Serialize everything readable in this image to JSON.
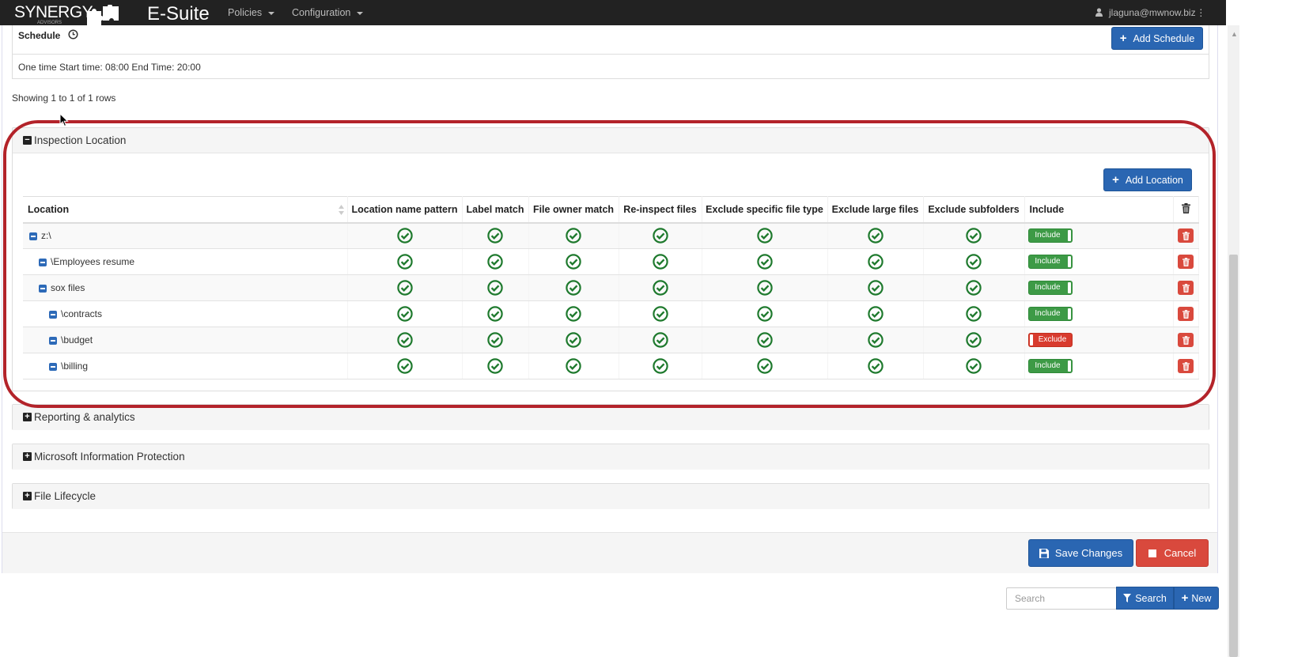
{
  "navbar": {
    "brand_synergy": "SYNERGY",
    "brand_sub": "ADVISORS",
    "brand_esuite": "E-Suite",
    "menu": [
      {
        "label": "Policies"
      },
      {
        "label": "Configuration"
      }
    ],
    "user_email": "jlaguna@mwnow.biz"
  },
  "schedule": {
    "title": "Schedule",
    "add_label": "Add Schedule",
    "entry": "One time Start time: 08:00 End Time: 20:00"
  },
  "showing": "Showing 1 to 1 of 1 rows",
  "inspection": {
    "title": "Inspection Location",
    "add_label": "Add Location",
    "columns": [
      "Location",
      "Location name pattern",
      "Label match",
      "File owner match",
      "Re-inspect files",
      "Exclude specific file type",
      "Exclude large files",
      "Exclude subfolders",
      "Include"
    ],
    "rows": [
      {
        "name": "z:\\",
        "level": 0,
        "include": "Include"
      },
      {
        "name": "\\Employees resume",
        "level": 1,
        "include": "Include"
      },
      {
        "name": "sox files",
        "level": 1,
        "include": "Include"
      },
      {
        "name": "\\contracts",
        "level": 2,
        "include": "Include"
      },
      {
        "name": "\\budget",
        "level": 2,
        "include": "Exclude"
      },
      {
        "name": "\\billing",
        "level": 2,
        "include": "Include"
      }
    ]
  },
  "sections": [
    {
      "title": "Reporting & analytics"
    },
    {
      "title": "Microsoft Information Protection"
    },
    {
      "title": "File Lifecycle"
    }
  ],
  "footer": {
    "save_label": "Save Changes",
    "cancel_label": "Cancel"
  },
  "search": {
    "placeholder": "Search",
    "search_label": "Search",
    "new_label": "New"
  },
  "colors": {
    "primary": "#2a66b2",
    "success": "#3d9a46",
    "danger": "#d9493d",
    "check": "#1f7a2e",
    "highlight": "#b3232a"
  }
}
